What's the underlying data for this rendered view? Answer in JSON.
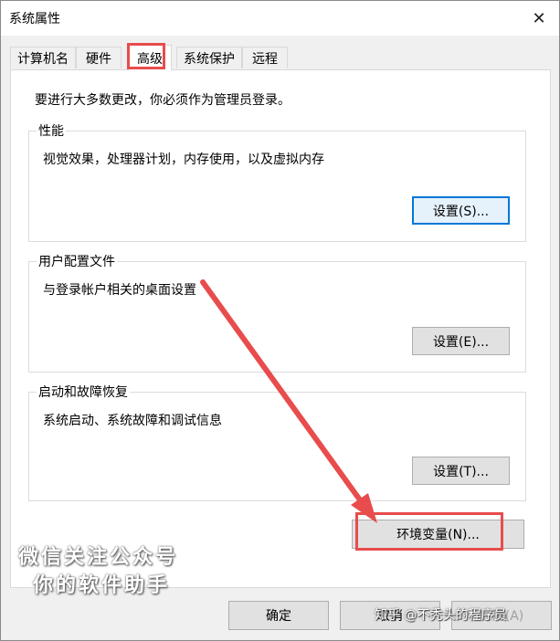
{
  "window": {
    "title": "系统属性"
  },
  "tabs": [
    {
      "label": "计算机名"
    },
    {
      "label": "硬件"
    },
    {
      "label": "高级",
      "active": true
    },
    {
      "label": "系统保护"
    },
    {
      "label": "远程"
    }
  ],
  "intro": "要进行大多数更改，你必须作为管理员登录。",
  "groups": {
    "performance": {
      "title": "性能",
      "description": "视觉效果，处理器计划，内存使用，以及虚拟内存",
      "button": "设置(S)..."
    },
    "user_profiles": {
      "title": "用户配置文件",
      "description": "与登录帐户相关的桌面设置",
      "button": "设置(E)..."
    },
    "startup": {
      "title": "启动和故障恢复",
      "description": "系统启动、系统故障和调试信息",
      "button": "设置(T)..."
    }
  },
  "env_button": "环境变量(N)...",
  "footer": {
    "ok": "确定",
    "cancel": "取消",
    "apply": "应用(A)"
  },
  "watermark": {
    "line1": "微信关注公众号",
    "line2": "你的软件助手"
  },
  "credit": "知乎 @不秃头的程序员",
  "annotation_color": "#e84c4c"
}
